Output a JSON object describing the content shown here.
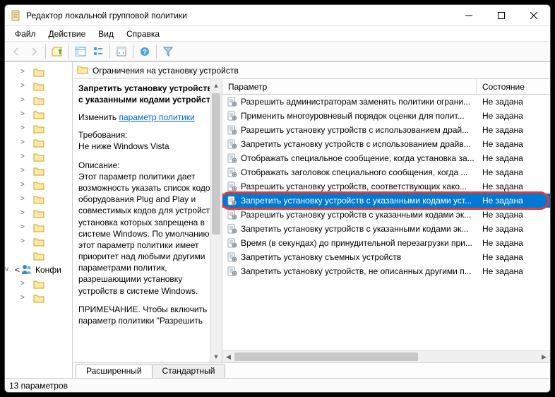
{
  "window": {
    "title": "Редактор локальной групповой политики"
  },
  "menu": {
    "file": "Файл",
    "action": "Действие",
    "view": "Вид",
    "help": "Справка"
  },
  "tree": {
    "items": [
      {
        "label": "",
        "expand": ">"
      },
      {
        "label": "",
        "expand": ">"
      },
      {
        "label": "",
        "expand": ">"
      },
      {
        "label": "",
        "expand": ">"
      },
      {
        "label": "",
        "expand": ">"
      },
      {
        "label": "",
        "expand": ">"
      },
      {
        "label": "",
        "expand": ">"
      },
      {
        "label": "",
        "expand": ">"
      },
      {
        "label": "",
        "expand": ">"
      },
      {
        "label": "",
        "expand": ">"
      },
      {
        "label": "",
        "expand": ">"
      },
      {
        "label": "",
        "expand": ">"
      },
      {
        "label": "",
        "expand": ">"
      },
      {
        "label": "",
        "expand": ""
      },
      {
        "label": "Конфи",
        "expand": "v",
        "icon": "users"
      },
      {
        "label": "",
        "expand": ">"
      },
      {
        "label": "",
        "expand": ">"
      }
    ],
    "left_chevron": "<"
  },
  "category": {
    "title": "Ограничения на установку устройств"
  },
  "description": {
    "heading": "Запретить установку устройств с указанными кодами устройств",
    "edit_label": "Изменить",
    "edit_link": "параметр политики",
    "req_label": "Требования:",
    "req_text": "Не ниже Windows Vista",
    "desc_label": "Описание:",
    "desc_text": "Этот параметр политики дает возможность указать список кодов оборудования Plug and Play и совместимых кодов для устройств, установка которых запрещена в системе Windows. По умолчанию этот параметр политики имеет приоритет над любыми другими параметрами политик, разрешающими установку устройств в системе Windows.",
    "note_text": "ПРИМЕЧАНИЕ. Чтобы включить параметр политики \"Разрешить"
  },
  "list": {
    "col_setting": "Параметр",
    "col_state": "Состояние",
    "rows": [
      {
        "label": "Разрешить администраторам заменять политики ограни...",
        "state": "Не задана"
      },
      {
        "label": "Применить многоуровневый порядок оценки для полит...",
        "state": "Не задана"
      },
      {
        "label": "Разрешить установку устройств с использованием драй...",
        "state": "Не задана"
      },
      {
        "label": "Запретить установку устройств с использованием драйв...",
        "state": "Не задана"
      },
      {
        "label": "Отображать специальное сообщение, когда установка за...",
        "state": "Не задана"
      },
      {
        "label": "Отображать заголовок специального сообщения, когда ...",
        "state": "Не задана"
      },
      {
        "label": "Разрешить установку устройств, соответствующих како...",
        "state": "Не задана"
      },
      {
        "label": "Запретить установку устройств с указанными кодами уст...",
        "state": "Не задана",
        "selected": true
      },
      {
        "label": "Разрешить установку устройств с указанными кодами эк...",
        "state": "Не задана"
      },
      {
        "label": "Запретить установку устройств с указанными кодами эк...",
        "state": "Не задана"
      },
      {
        "label": "Время (в секундах) до принудительной перезагрузки при...",
        "state": "Не задана"
      },
      {
        "label": "Запретить установку съемных устройств",
        "state": "Не задана"
      },
      {
        "label": "Запретить установку устройств, не описанных другими п...",
        "state": "Не задана"
      }
    ]
  },
  "tabs": {
    "extended": "Расширенный",
    "standard": "Стандартный"
  },
  "status": {
    "text": "13 параметров"
  }
}
